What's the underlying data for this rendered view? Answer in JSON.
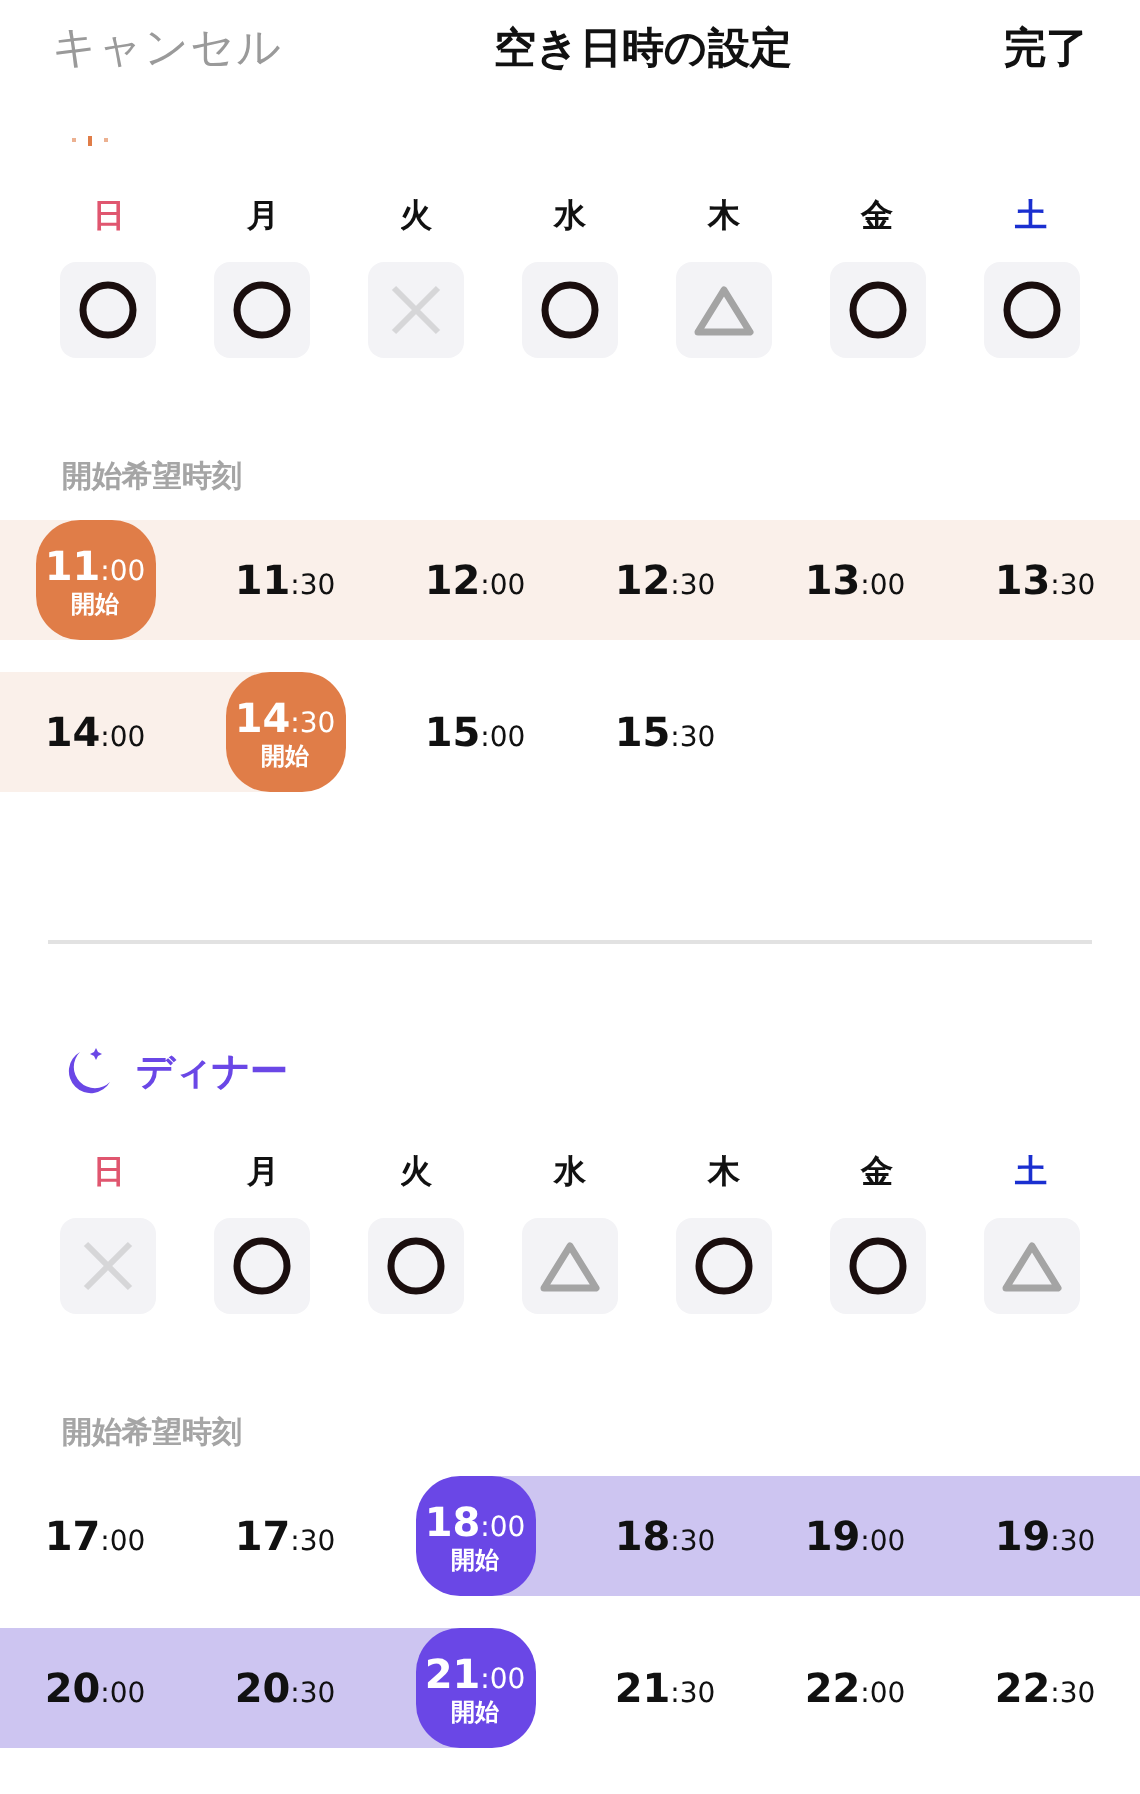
{
  "header": {
    "cancel": "キャンセル",
    "title": "空き日時の設定",
    "done": "完了"
  },
  "sections": [
    {
      "kind": "lunch",
      "days": [
        {
          "label": "日",
          "color": "#e0566f",
          "kind": "circle"
        },
        {
          "label": "月",
          "color": "#111111",
          "kind": "circle"
        },
        {
          "label": "火",
          "color": "#111111",
          "kind": "cross"
        },
        {
          "label": "水",
          "color": "#111111",
          "kind": "circle"
        },
        {
          "label": "木",
          "color": "#111111",
          "kind": "triangle"
        },
        {
          "label": "金",
          "color": "#111111",
          "kind": "circle"
        },
        {
          "label": "土",
          "color": "#1a2fd0",
          "kind": "circle"
        }
      ],
      "time_label": "開始希望時刻",
      "rows": [
        [
          {
            "hour": "11",
            "minute": ":00",
            "start": true,
            "in_range": true,
            "badge": "開始"
          },
          {
            "hour": "11",
            "minute": ":30",
            "start": false,
            "in_range": true
          },
          {
            "hour": "12",
            "minute": ":00",
            "start": false,
            "in_range": true
          },
          {
            "hour": "12",
            "minute": ":30",
            "start": false,
            "in_range": true
          },
          {
            "hour": "13",
            "minute": ":00",
            "start": false,
            "in_range": true
          },
          {
            "hour": "13",
            "minute": ":30",
            "start": false,
            "in_range": true
          }
        ],
        [
          {
            "hour": "14",
            "minute": ":00",
            "start": false,
            "in_range": true
          },
          {
            "hour": "14",
            "minute": ":30",
            "start": true,
            "in_range": true,
            "badge": "開始"
          },
          {
            "hour": "15",
            "minute": ":00",
            "start": false,
            "in_range": false
          },
          {
            "hour": "15",
            "minute": ":30",
            "start": false,
            "in_range": false
          }
        ]
      ]
    },
    {
      "kind": "dinner",
      "title": "ディナー",
      "days": [
        {
          "label": "日",
          "color": "#e0566f",
          "kind": "cross"
        },
        {
          "label": "月",
          "color": "#111111",
          "kind": "circle"
        },
        {
          "label": "火",
          "color": "#111111",
          "kind": "circle"
        },
        {
          "label": "水",
          "color": "#111111",
          "kind": "triangle"
        },
        {
          "label": "木",
          "color": "#111111",
          "kind": "circle"
        },
        {
          "label": "金",
          "color": "#111111",
          "kind": "circle"
        },
        {
          "label": "土",
          "color": "#1a2fd0",
          "kind": "triangle"
        }
      ],
      "time_label": "開始希望時刻",
      "rows": [
        [
          {
            "hour": "17",
            "minute": ":00",
            "start": false,
            "in_range": false
          },
          {
            "hour": "17",
            "minute": ":30",
            "start": false,
            "in_range": false
          },
          {
            "hour": "18",
            "minute": ":00",
            "start": true,
            "in_range": true,
            "badge": "開始"
          },
          {
            "hour": "18",
            "minute": ":30",
            "start": false,
            "in_range": true
          },
          {
            "hour": "19",
            "minute": ":00",
            "start": false,
            "in_range": true
          },
          {
            "hour": "19",
            "minute": ":30",
            "start": false,
            "in_range": true
          }
        ],
        [
          {
            "hour": "20",
            "minute": ":00",
            "start": false,
            "in_range": true
          },
          {
            "hour": "20",
            "minute": ":30",
            "start": false,
            "in_range": true
          },
          {
            "hour": "21",
            "minute": ":00",
            "start": true,
            "in_range": true,
            "badge": "開始"
          },
          {
            "hour": "21",
            "minute": ":30",
            "start": false,
            "in_range": false
          },
          {
            "hour": "22",
            "minute": ":00",
            "start": false,
            "in_range": false
          },
          {
            "hour": "22",
            "minute": ":30",
            "start": false,
            "in_range": false
          }
        ]
      ]
    }
  ]
}
